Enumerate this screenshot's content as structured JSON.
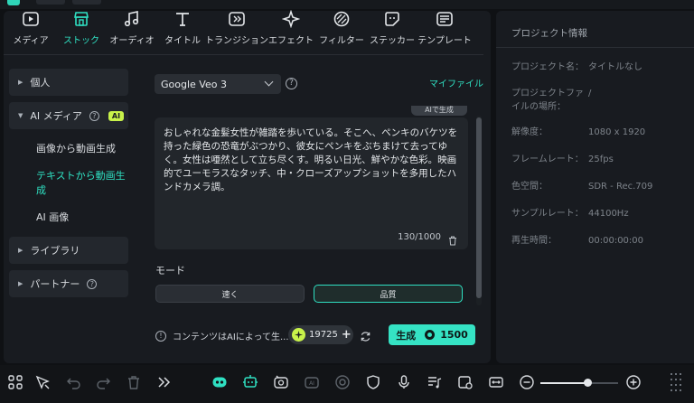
{
  "tabs": [
    {
      "label": "メディア",
      "icon": "media-icon"
    },
    {
      "label": "ストック",
      "icon": "stock-icon",
      "active": true
    },
    {
      "label": "オーディオ",
      "icon": "music-note-icon"
    },
    {
      "label": "タイトル",
      "icon": "title-t-icon"
    },
    {
      "label": "トランジション",
      "icon": "transition-icon"
    },
    {
      "label": "エフェクト",
      "icon": "effect-sparkle-icon"
    },
    {
      "label": "フィルター",
      "icon": "filter-icon"
    },
    {
      "label": "ステッカー",
      "icon": "sticker-icon"
    },
    {
      "label": "テンプレート",
      "icon": "template-icon"
    }
  ],
  "nav": {
    "personal": "個人",
    "ai_media": "AI メディア",
    "ai_badge": "AI",
    "image_to_video": "画像から動画生成",
    "text_to_video": "テキストから動画生成",
    "ai_image": "AI 画像",
    "library": "ライブラリ",
    "partner": "パートナー"
  },
  "content": {
    "model": "Google Veo 3",
    "my_file": "マイファイル",
    "ai_chip": "AIで生成",
    "prompt": "おしゃれな金髪女性が雑踏を歩いている。そこへ、ペンキのバケツを持った緑色の恐竜がぶつかり、彼女にペンキをぶちまけて去ってゆく。女性は唖然として立ち尽くす。明るい日光、鮮やかな色彩。映画的でユーモラスなタッチ、中・クローズアップショットを多用したハンドカメラ調。",
    "counter": "130/1000",
    "mode_label": "モード",
    "mode_fast": "速く",
    "mode_quality": "品質",
    "notice": "コンテンツはAIによって生...",
    "credits": "19725",
    "generate_label": "生成",
    "generate_cost": "1500"
  },
  "project": {
    "title": "プロジェクト情報",
    "props": [
      {
        "label": "プロジェクト名：",
        "value": "タイトルなし"
      },
      {
        "label": "プロジェクトファイルの場所：",
        "value": "/"
      },
      {
        "label": "解像度：",
        "value": "1080 x 1920"
      },
      {
        "label": "フレームレート：",
        "value": "25fps"
      },
      {
        "label": "色空間：",
        "value": "SDR - Rec.709"
      },
      {
        "label": "サンプルレート：",
        "value": "44100Hz"
      },
      {
        "label": "再生時間：",
        "value": "00:00:00:00"
      }
    ]
  },
  "bottom_toolbar": {
    "icons": [
      "grid-icon",
      "select-cursor-icon",
      "undo-icon",
      "redo-icon",
      "delete-icon",
      "more-chevron-icon",
      "ai-robot-icon",
      "ai-copilot-icon",
      "motion-icon",
      "ai-effect-icon",
      "record-icon",
      "shield-icon",
      "mic-icon",
      "audio-list-icon",
      "clip-icon",
      "fit-icon",
      "zoom-out-icon",
      "zoom-in-icon",
      "grip-icon"
    ],
    "zoom_level": 0.6
  },
  "colors": {
    "accent": "#2fe0c2",
    "ai_badge": "#c8f24a",
    "generate": "#35e3c4"
  }
}
